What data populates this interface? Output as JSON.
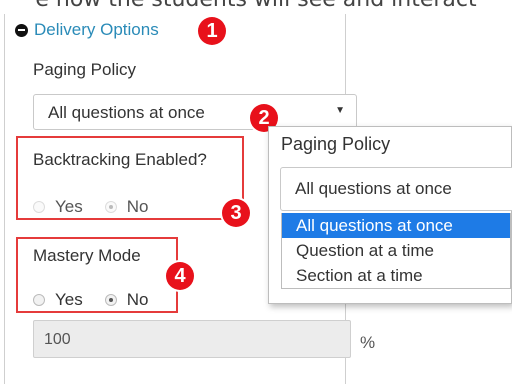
{
  "caption": "e how the students will see and interact",
  "section": {
    "title": "Delivery Options",
    "badge": "1"
  },
  "paging": {
    "label": "Paging Policy",
    "selected": "All questions at once",
    "badge": "2"
  },
  "backtracking": {
    "label": "Backtracking Enabled?",
    "yes": "Yes",
    "no": "No",
    "selected": "No",
    "badge": "3"
  },
  "mastery": {
    "label": "Mastery Mode",
    "yes": "Yes",
    "no": "No",
    "selected": "No",
    "badge": "4",
    "value": "100",
    "unit": "%"
  },
  "popup": {
    "title": "Paging Policy",
    "current": "All questions at once",
    "options": [
      "All questions at once",
      "Question at a time",
      "Section at a time"
    ],
    "highlighted": "All questions at once"
  },
  "colors": {
    "badge": "#e8111b",
    "highlight": "#1e7be6",
    "link": "#2a8bb8",
    "annotation_box": "#e53b3b"
  }
}
